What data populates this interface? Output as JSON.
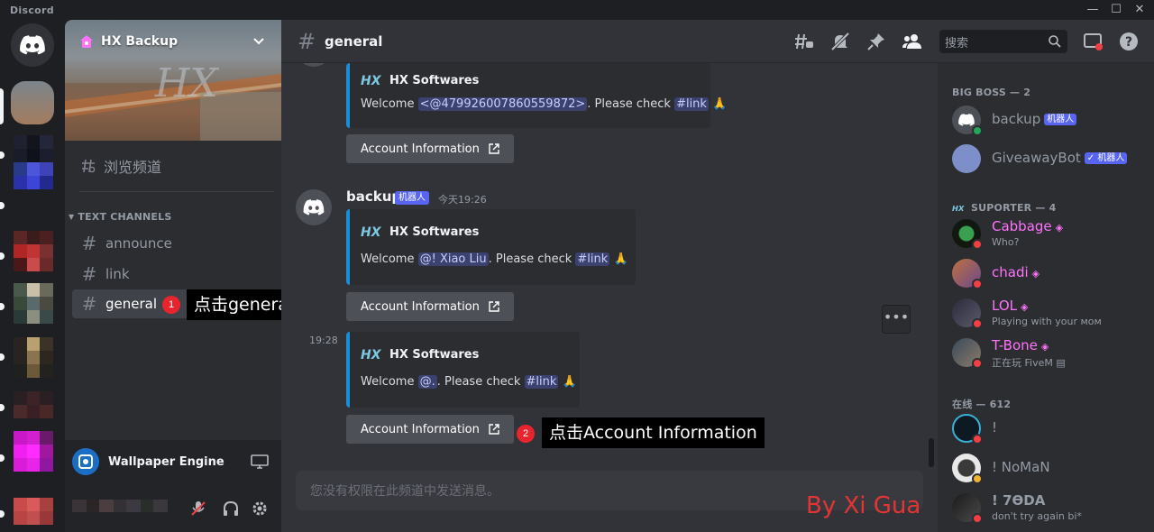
{
  "app": {
    "title": "Discord"
  },
  "server": {
    "name": "HX Backup"
  },
  "sidebar": {
    "browse_label": "浏览频道",
    "category": "TEXT CHANNELS",
    "channels": [
      {
        "name": "announce"
      },
      {
        "name": "link"
      },
      {
        "name": "general"
      }
    ],
    "activity": "Wallpaper Engine"
  },
  "header": {
    "channel": "general",
    "search_placeholder": "搜索"
  },
  "messages": {
    "embed_author": "HX Softwares",
    "embeds": [
      {
        "pre": "Welcome ",
        "mention": "<@479926007860559872>",
        "mid": ". Please check ",
        "link": "#link",
        "emoji": "🙏"
      },
      {
        "pre": "Welcome ",
        "mention": "@!  Xiao Liu",
        "mid": ". Please check ",
        "link": "#link",
        "emoji": "🙏"
      },
      {
        "pre": "Welcome ",
        "mention": "@.",
        "mid": ". Please check ",
        "link": "#link",
        "emoji": "🙏"
      }
    ],
    "button_label": "Account Information",
    "author": "backup",
    "bot_tag": "机器人",
    "timestamp": "今天19:26",
    "side_time": "19:28",
    "more": "•••",
    "input_placeholder": "您没有权限在此频道中发送消息。"
  },
  "annotations": {
    "step1_num": "1",
    "step1_text": "点击general",
    "step2_num": "2",
    "step2_text": "点击Account Information",
    "watermark": "By Xi Gua"
  },
  "members": {
    "groups": [
      {
        "title": "BIG BOSS — 2"
      },
      {
        "title": "SUPORTER — 4"
      },
      {
        "title": "在线 — 612"
      }
    ],
    "list": [
      {
        "name": "backup",
        "tag": "机器人",
        "sub": ""
      },
      {
        "name": "GiveawayBot",
        "tag": "✓ 机器人",
        "sub": ""
      },
      {
        "name": "Cabbage",
        "sub": "Who?"
      },
      {
        "name": "chadi",
        "sub": ""
      },
      {
        "name": "LOL",
        "sub": "Playing with your ᴍᴏᴍ"
      },
      {
        "name": "T-Bone",
        "sub": "正在玩 FiveM"
      },
      {
        "name": "!",
        "sub": ""
      },
      {
        "name": "! NoMaN",
        "sub": ""
      },
      {
        "name": "! 7ϴDA",
        "sub": "don't try again bi*"
      }
    ],
    "colors": {
      "booster": "#ff73fa",
      "dnd": "#f23f43",
      "online": "#23a55a",
      "idle": "#f0b232"
    }
  }
}
